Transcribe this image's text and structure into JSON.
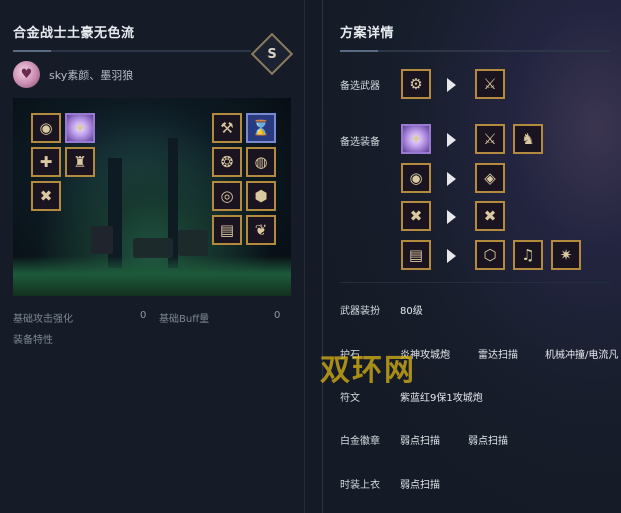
{
  "left": {
    "title": "合金战士土豪无色流",
    "rank_badge": "S",
    "author_names": "sky素颜、墨羽狼",
    "equipment_slots": [
      {
        "icon": "shoulder-armor-icon",
        "glyph": "◉"
      },
      {
        "icon": "glowing-aura-icon",
        "glyph": "✦"
      },
      {
        "icon": "chest-armor-icon",
        "glyph": "✚"
      },
      {
        "icon": "helmet-icon",
        "glyph": "♜"
      },
      {
        "icon": "belt-icon",
        "glyph": "✖"
      },
      {
        "icon": "weapon-icon",
        "glyph": "⚒"
      },
      {
        "icon": "title-icon",
        "glyph": "⌛"
      },
      {
        "icon": "bracelet-icon",
        "glyph": "❂"
      },
      {
        "icon": "necklace-icon",
        "glyph": "◍"
      },
      {
        "icon": "ring-icon",
        "glyph": "◎"
      },
      {
        "icon": "sub-equipment-icon",
        "glyph": "⬢"
      },
      {
        "icon": "earring-icon",
        "glyph": "▤"
      },
      {
        "icon": "magic-stone-icon",
        "glyph": "❦"
      }
    ],
    "stats": [
      {
        "label": "基础攻击强化",
        "value": "0"
      },
      {
        "label": "基础Buff量",
        "value": "0"
      }
    ],
    "equip_traits_label": "装备特性"
  },
  "right": {
    "title": "方案详情",
    "weapon_label": "备选武器",
    "weapon_from": {
      "icon": "arm-cannon-icon",
      "glyph": "⚙"
    },
    "weapon_to": [
      {
        "icon": "gun-weapon-icon",
        "glyph": "⚔"
      }
    ],
    "equipment_label": "备选装备",
    "equipment_swaps": [
      {
        "from": {
          "icon": "glowing-aura-icon",
          "glyph": "✦"
        },
        "to": [
          {
            "icon": "dark-armor-icon",
            "glyph": "⚔"
          },
          {
            "icon": "dark-armor-icon",
            "glyph": "♞"
          }
        ]
      },
      {
        "from": {
          "icon": "shoulder-armor-icon",
          "glyph": "◉"
        },
        "to": [
          {
            "icon": "dark-greaves-icon",
            "glyph": "◈"
          }
        ]
      },
      {
        "from": {
          "icon": "belt-icon",
          "glyph": "✖"
        },
        "to": [
          {
            "icon": "dark-belt-icon",
            "glyph": "✖"
          }
        ]
      },
      {
        "from": {
          "icon": "earring-icon",
          "glyph": "▤"
        },
        "to": [
          {
            "icon": "cube-icon",
            "glyph": "⬡"
          },
          {
            "icon": "bell-icon",
            "glyph": "♫"
          },
          {
            "icon": "claw-icon",
            "glyph": "✷"
          }
        ]
      }
    ],
    "rows": [
      {
        "label": "武器装扮",
        "values": [
          "80级"
        ]
      },
      {
        "label": "护石",
        "values": [
          "炎神攻城炮",
          "雷达扫描",
          "机械冲撞/电流凡"
        ]
      },
      {
        "label": "符文",
        "values": [
          "紫蓝红9保1攻城炮"
        ]
      },
      {
        "label": "白金徽章",
        "values": [
          "弱点扫描",
          "弱点扫描"
        ]
      },
      {
        "label": "时装上衣",
        "values": [
          "弱点扫描"
        ]
      }
    ]
  },
  "watermark": "双环网"
}
